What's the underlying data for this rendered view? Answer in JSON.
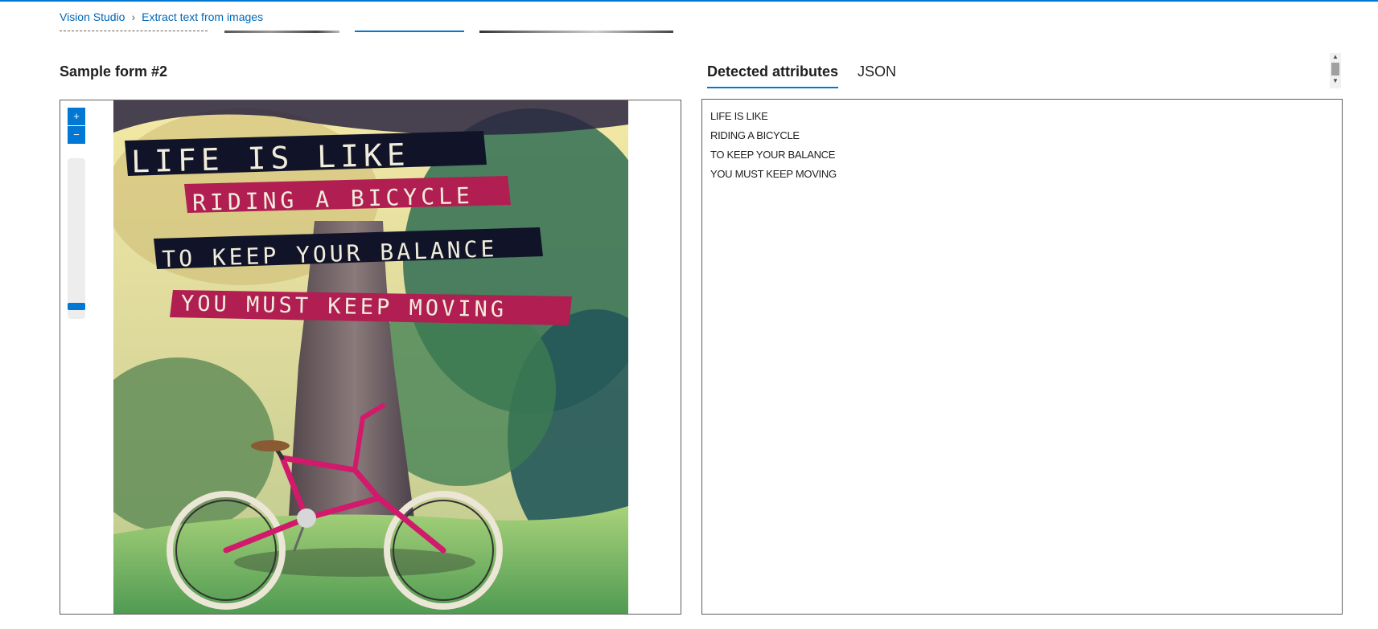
{
  "app": {
    "breadcrumb": [
      "Vision Studio",
      "Extract text from images"
    ]
  },
  "sample_title": "Sample form #2",
  "tabs": [
    {
      "label": "Detected attributes",
      "active": true
    },
    {
      "label": "JSON",
      "active": false
    }
  ],
  "zoom_controls": {
    "zoom_in_icon": "+",
    "zoom_out_icon": "−"
  },
  "image_ocr_text": [
    "LIFE IS LIKE",
    "RIDING A BICYCLE",
    "TO KEEP YOUR BALANCE",
    "YOU MUST KEEP MOVING"
  ],
  "detected_lines": [
    "LIFE IS LIKE",
    "RIDING A BICYCLE",
    "TO KEEP YOUR BALANCE",
    "YOU MUST KEEP MOVING"
  ],
  "colors": {
    "accent": "#0078d4",
    "banner_dark": "#111428",
    "banner_pink": "#b01e52",
    "bike": "#d11a6b"
  }
}
